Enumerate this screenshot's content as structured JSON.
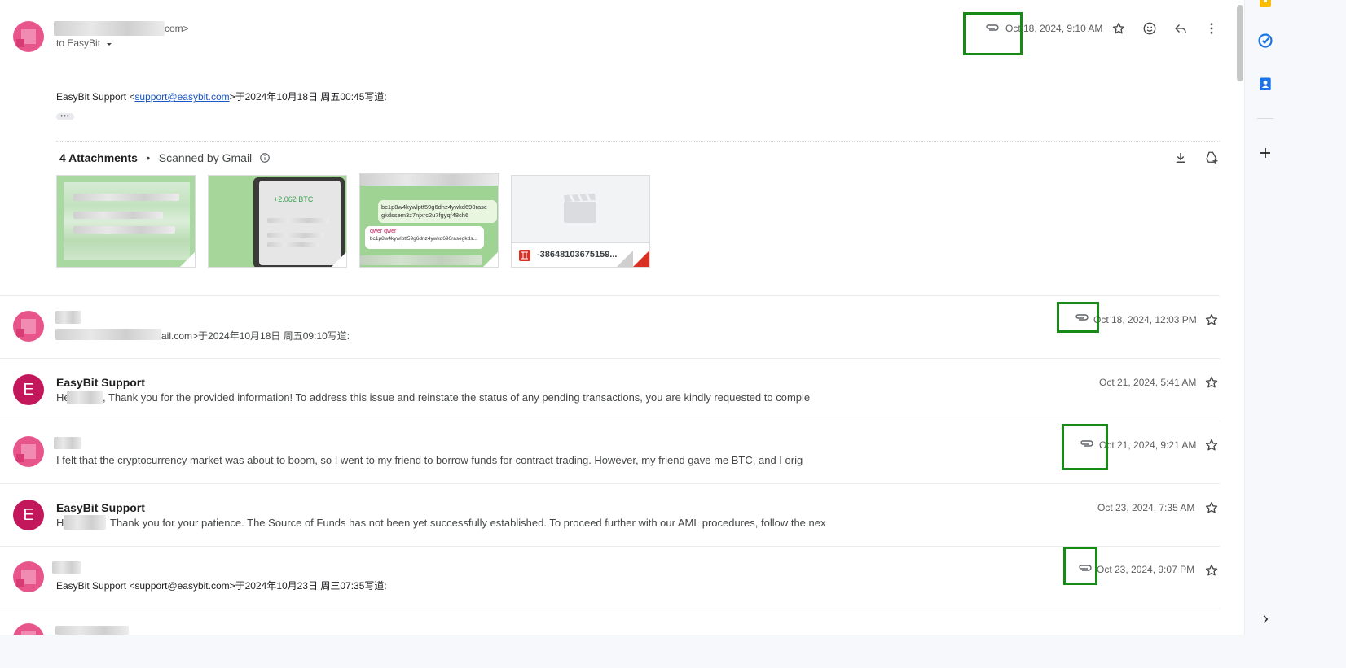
{
  "top_message": {
    "sender_email_tail": "com>",
    "to_label": "to EasyBit",
    "date": "Oct 18, 2024, 9:10 AM",
    "quote_prefix": "EasyBit Support <",
    "quote_email": "support@easybit.com",
    "quote_suffix": ">于2024年10月18日 周五00:45写道:",
    "show_trimmed": "•••"
  },
  "attachments": {
    "title": "4 Attachments",
    "separator": "•",
    "scanned": "Scanned by Gmail",
    "thumb2_btc": "+2.062 BTC",
    "thumb3_addr1": "bc1p8w4kywlptf59g6dnz4ywkd690rase",
    "thumb3_addr2": "gkdssem3z7njxrc2u7fgyqf48ch6",
    "thumb3_reply_name": "qwer qwer",
    "thumb3_reply_text": "bc1p8w4kywlptf59g6dnz4ywkd690rasegkds...",
    "video_filename": "-38648103675159..."
  },
  "messages": [
    {
      "sender": "",
      "snippet": "ail.com>于2024年10月18日 周五09:10写道:",
      "date": "Oct 18, 2024, 12:03 PM",
      "avatar_letter": ""
    },
    {
      "sender": "EasyBit Support",
      "snippet_a": "He",
      "snippet_b": ", Thank you for the provided information! To address this issue and reinstate the status of any pending transactions, you are kindly requested to comple",
      "date": "Oct 21, 2024, 5:41 AM",
      "avatar_letter": "E"
    },
    {
      "sender": "",
      "snippet": "I felt that the cryptocurrency market was about to boom, so I went to my friend to borrow funds for contract trading. However, my friend gave me BTC, and I orig",
      "date": "Oct 21, 2024, 9:21 AM",
      "avatar_letter": ""
    },
    {
      "sender": "EasyBit Support",
      "snippet_a": "H",
      "snippet_b": "Thank you for your patience. The Source of Funds has not been yet successfully established. To proceed further with our AML procedures, follow the nex",
      "date": "Oct 23, 2024, 7:35 AM",
      "avatar_letter": "E"
    },
    {
      "sender": "",
      "snippet": "EasyBit Support <support@easybit.com>于2024年10月23日 周三07:35写道:",
      "date": "Oct 23, 2024, 9:07 PM",
      "avatar_letter": ""
    }
  ],
  "colors": {
    "highlight": "#178a17",
    "link": "#1a57c7",
    "avatar_pink": "#e8558a",
    "avatar_e": "#c2185b"
  }
}
